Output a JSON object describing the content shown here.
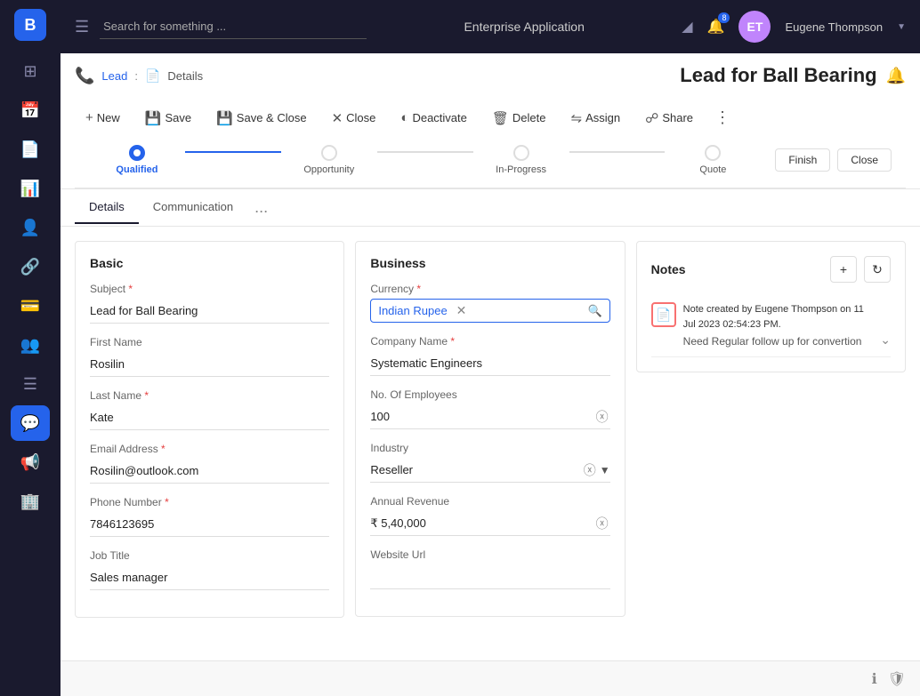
{
  "sidebar": {
    "logo": "B",
    "items": [
      {
        "id": "dashboard",
        "icon": "⊞",
        "active": false
      },
      {
        "id": "calendar",
        "icon": "📅",
        "active": false
      },
      {
        "id": "document",
        "icon": "📄",
        "active": false
      },
      {
        "id": "chart",
        "icon": "📊",
        "active": false
      },
      {
        "id": "contacts",
        "icon": "👤",
        "active": false
      },
      {
        "id": "network",
        "icon": "🔗",
        "active": false
      },
      {
        "id": "wallet",
        "icon": "💳",
        "active": false
      },
      {
        "id": "people",
        "icon": "👥",
        "active": false
      },
      {
        "id": "list",
        "icon": "☰",
        "active": false
      },
      {
        "id": "chat",
        "icon": "💬",
        "active": true
      },
      {
        "id": "megaphone",
        "icon": "📢",
        "active": false
      },
      {
        "id": "building",
        "icon": "🏢",
        "active": false
      }
    ]
  },
  "topbar": {
    "search_placeholder": "Search for something ...",
    "app_name": "Enterprise Application",
    "bell_count": "8",
    "username": "Eugene Thompson",
    "avatar_initials": "ET"
  },
  "page": {
    "breadcrumb_icon": "📞",
    "breadcrumb_lead": "Lead",
    "breadcrumb_sep": ":",
    "breadcrumb_details": "Details",
    "title": "Lead for Ball Bearing",
    "bell_icon": "🔔"
  },
  "toolbar": {
    "new_label": "New",
    "save_label": "Save",
    "save_close_label": "Save & Close",
    "close_label": "Close",
    "deactivate_label": "Deactivate",
    "delete_label": "Delete",
    "assign_label": "Assign",
    "share_label": "Share"
  },
  "pipeline": {
    "steps": [
      {
        "id": "qualified",
        "label": "Qualified",
        "active": true
      },
      {
        "id": "opportunity",
        "label": "Opportunity",
        "active": false
      },
      {
        "id": "in-progress",
        "label": "In-Progress",
        "active": false
      },
      {
        "id": "quote",
        "label": "Quote",
        "active": false
      }
    ],
    "finish_label": "Finish",
    "close_label": "Close"
  },
  "tabs": {
    "items": [
      {
        "id": "details",
        "label": "Details",
        "active": true
      },
      {
        "id": "communication",
        "label": "Communication",
        "active": false
      }
    ]
  },
  "basic": {
    "title": "Basic",
    "subject_label": "Subject",
    "subject_value": "Lead for Ball Bearing",
    "firstname_label": "First Name",
    "firstname_value": "Rosilin",
    "lastname_label": "Last Name",
    "lastname_value": "Kate",
    "email_label": "Email Address",
    "email_value": "Rosilin@outlook.com",
    "phone_label": "Phone Number",
    "phone_value": "7846123695",
    "jobtitle_label": "Job Title",
    "jobtitle_value": "Sales manager"
  },
  "business": {
    "title": "Business",
    "currency_label": "Currency",
    "currency_value": "Indian Rupee",
    "company_label": "Company Name",
    "company_value": "Systematic Engineers",
    "employees_label": "No. Of Employees",
    "employees_value": "100",
    "industry_label": "Industry",
    "industry_value": "Reseller",
    "revenue_label": "Annual Revenue",
    "revenue_value": "₹ 5,40,000",
    "website_label": "Website Url",
    "website_value": ""
  },
  "notes": {
    "title": "Notes",
    "add_label": "+",
    "refresh_label": "↻",
    "note": {
      "meta": "Note created by Eugene\nThompson on 11 Jul 2023\n02:54:23 PM.",
      "text": "Need Regular follow up for convertion"
    }
  },
  "bottom": {
    "info_icon": "ℹ",
    "shield_icon": "🛡"
  }
}
